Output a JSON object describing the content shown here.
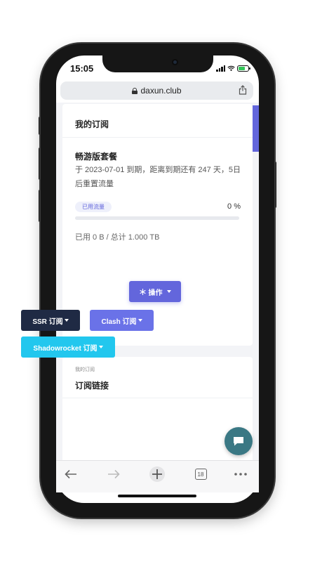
{
  "status_bar": {
    "time": "15:05"
  },
  "browser": {
    "url": "daxun.club",
    "open_tabs": "18"
  },
  "subscription_card": {
    "title": "我的订阅",
    "plan_name": "畅游版套餐",
    "plan_description": "于 2023-07-01 到期，距离到期还有 247 天，5日后重置流量",
    "usage_label": "已用流量",
    "usage_percent_text": "0 %",
    "usage_fraction": 0,
    "usage_detail": "已用 0 B / 总计 1.000 TB",
    "action_button": "操作"
  },
  "links_card": {
    "subtitle": "我的订阅",
    "title": "订阅链接",
    "buttons": {
      "ssr": "SSR 订阅",
      "clash": "Clash 订阅",
      "shadowrocket": "Shadowrocket 订阅"
    }
  },
  "colors": {
    "primary": "#6366dc",
    "ssr": "#1f2a44",
    "clash": "#6a72e8",
    "shadowrocket": "#22c7ee",
    "chat": "#3a7884"
  },
  "icons": [
    "lock-icon",
    "share-icon",
    "snowflake-icon",
    "chat-icon",
    "back-arrow-icon",
    "forward-arrow-icon",
    "new-tab-icon",
    "tabs-icon",
    "more-icon"
  ]
}
